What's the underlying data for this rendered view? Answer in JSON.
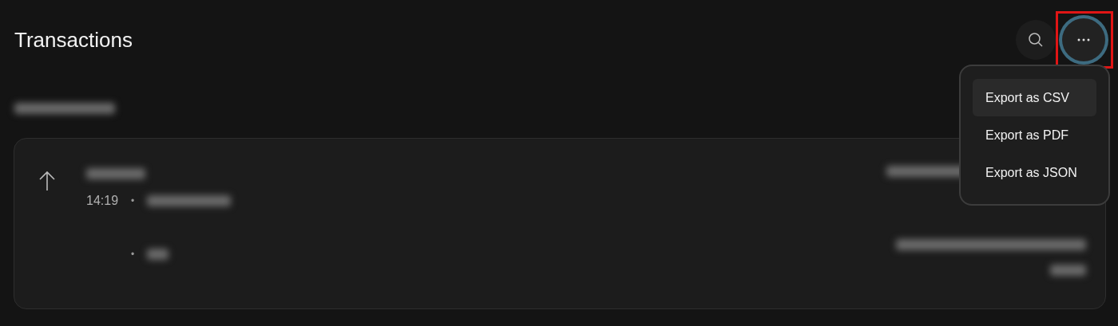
{
  "header": {
    "title": "Transactions",
    "search_button": {
      "focused": false
    },
    "more_button": {
      "focused": true,
      "highlighted_by_annotation": true
    }
  },
  "menu": {
    "open": true,
    "items": [
      {
        "label": "Export as CSV",
        "hovered": true
      },
      {
        "label": "Export as PDF",
        "hovered": false
      },
      {
        "label": "Export as JSON",
        "hovered": false
      }
    ]
  },
  "transaction": {
    "outgoing": true,
    "time": "14:19",
    "separator": "•",
    "fee_separator": "•"
  }
}
